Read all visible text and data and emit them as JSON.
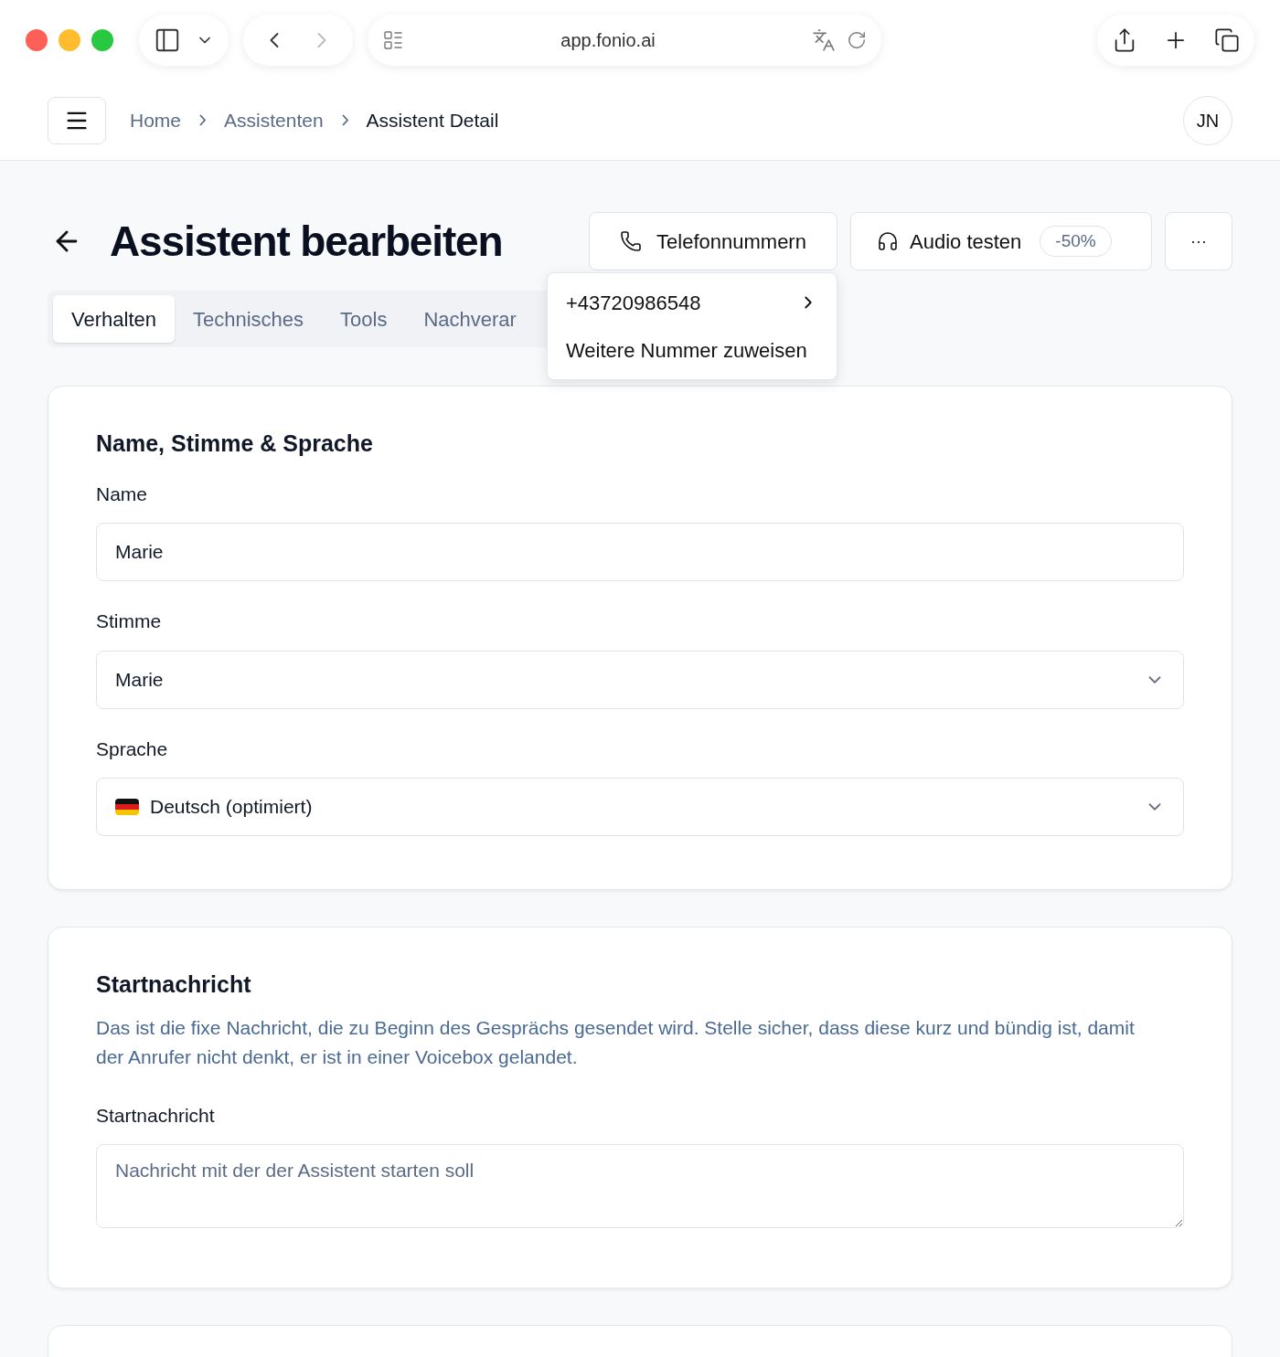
{
  "browser": {
    "url": "app.fonio.ai"
  },
  "breadcrumb": [
    {
      "label": "Home",
      "current": false
    },
    {
      "label": "Assistenten",
      "current": false
    },
    {
      "label": "Assistent Detail",
      "current": true
    }
  ],
  "user": {
    "initials": "JN"
  },
  "page": {
    "title": "Assistent bearbeiten"
  },
  "actions": {
    "phone_button": "Telefonnummern",
    "audio_button": "Audio testen",
    "audio_badge": "-50%",
    "more_button": "···"
  },
  "phone_menu": {
    "items": [
      {
        "label": "+43720986548",
        "has_submenu": true
      },
      {
        "label": "Weitere Nummer zuweisen",
        "has_submenu": false
      }
    ]
  },
  "tabs": [
    {
      "label": "Verhalten",
      "selected": true
    },
    {
      "label": "Technisches",
      "selected": false
    },
    {
      "label": "Tools",
      "selected": false
    },
    {
      "label": "Nachverar",
      "selected": false
    }
  ],
  "sections": [
    {
      "title": "Name, Stimme & Sprache",
      "fields": [
        {
          "kind": "text",
          "label": "Name",
          "value": "Marie"
        },
        {
          "kind": "select",
          "label": "Stimme",
          "value": "Marie"
        },
        {
          "kind": "select_flag",
          "label": "Sprache",
          "value": "Deutsch (optimiert)"
        }
      ]
    },
    {
      "title": "Startnachricht",
      "description": "Das ist die fixe Nachricht, die zu Beginn des Gesprächs gesendet wird. Stelle sicher, dass diese kurz und bündig ist, damit der Anrufer nicht denkt, er ist in einer Voicebox gelandet.",
      "fields": [
        {
          "kind": "textarea",
          "label": "Startnachricht",
          "placeholder": "Nachricht mit der der Assistent starten soll"
        }
      ]
    }
  ]
}
